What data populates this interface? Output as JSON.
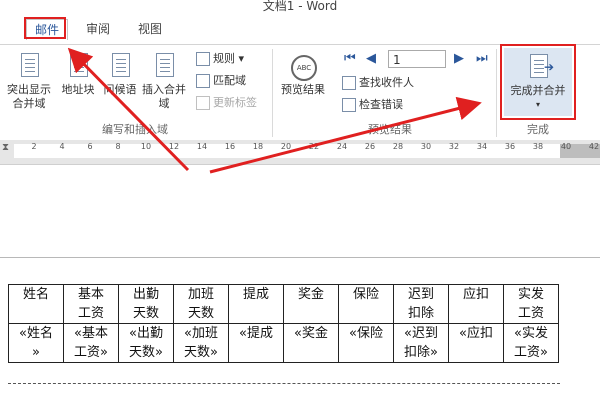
{
  "titlebar": {
    "title": "文档1 - Word"
  },
  "tabs": [
    {
      "label": "邮件",
      "active": true
    },
    {
      "label": "审阅",
      "active": false
    },
    {
      "label": "视图",
      "active": false
    }
  ],
  "ribbon": {
    "groups": {
      "write_insert": {
        "label": "编写和插入域",
        "highlight_merge_fields": "突出显示合并域",
        "address_block": "地址块",
        "greeting_line": "问候语",
        "insert_merge_field": "插入合并域",
        "rules": "规则",
        "match_fields": "匹配域",
        "update_labels": "更新标签"
      },
      "preview": {
        "label": "预览结果",
        "preview_results": "预览结果",
        "record_value": "1",
        "find_recipient": "查找收件人",
        "check_errors": "检查错误"
      },
      "finish": {
        "label": "完成",
        "finish_merge": "完成并合并"
      }
    }
  },
  "ruler": {
    "ticks": [
      "2",
      "4",
      "6",
      "8",
      "10",
      "12",
      "14",
      "16",
      "18",
      "20",
      "22",
      "24",
      "26",
      "28",
      "30",
      "32",
      "34",
      "36",
      "38",
      "40",
      "42"
    ]
  },
  "table": {
    "headers": [
      [
        "姓名",
        ""
      ],
      [
        "基本",
        "工资"
      ],
      [
        "出勤",
        "天数"
      ],
      [
        "加班",
        "天数"
      ],
      [
        "提成",
        ""
      ],
      [
        "奖金",
        ""
      ],
      [
        "保险",
        ""
      ],
      [
        "迟到",
        "扣除"
      ],
      [
        "应扣",
        ""
      ],
      [
        "实发",
        "工资"
      ]
    ],
    "fields": [
      [
        "«姓名",
        "»"
      ],
      [
        "«基本",
        "工资»"
      ],
      [
        "«出勤",
        "天数»"
      ],
      [
        "«加班",
        "天数»"
      ],
      [
        "«提成",
        ""
      ],
      [
        "«奖金",
        ""
      ],
      [
        "«保险",
        ""
      ],
      [
        "«迟到",
        "扣除»"
      ],
      [
        "«应扣",
        ""
      ],
      [
        "«实发",
        "工资»"
      ]
    ]
  },
  "colors": {
    "accent": "#2b579a",
    "annotation": "#e02020"
  }
}
